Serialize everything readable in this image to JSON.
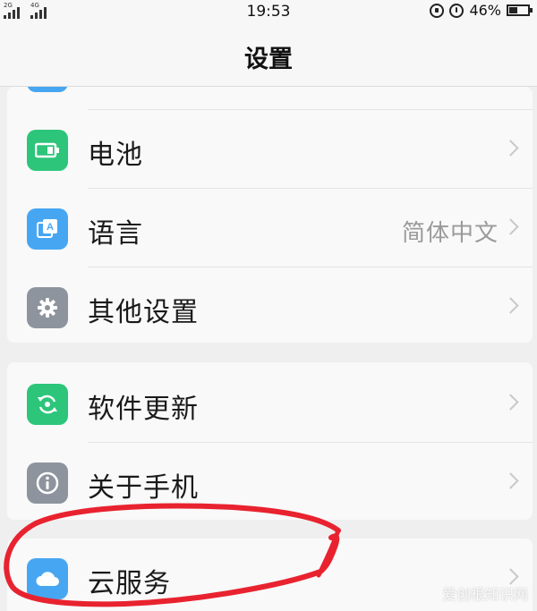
{
  "status_bar": {
    "network_1": "2G",
    "network_2": "4G",
    "time": "19:53",
    "battery_percent": "46%",
    "battery_level": 0.46
  },
  "header": {
    "title": "设置"
  },
  "group1": {
    "items": [
      {
        "label": "电池",
        "value": "",
        "icon": "battery-icon",
        "color": "#2dc57a"
      },
      {
        "label": "语言",
        "value": "简体中文",
        "icon": "language-icon",
        "color": "#47a6f2"
      },
      {
        "label": "其他设置",
        "value": "",
        "icon": "gear-icon",
        "color": "#8e949e"
      }
    ]
  },
  "group2": {
    "items": [
      {
        "label": "软件更新",
        "value": "",
        "icon": "update-icon",
        "color": "#2dc57a"
      },
      {
        "label": "关于手机",
        "value": "",
        "icon": "info-icon",
        "color": "#8e949e"
      }
    ]
  },
  "group3": {
    "items": [
      {
        "label": "云服务",
        "value": "",
        "icon": "cloud-icon",
        "color": "#47a6f2"
      }
    ]
  },
  "annotation": {
    "color": "#e8232f"
  },
  "watermark": "爱创根知识网"
}
